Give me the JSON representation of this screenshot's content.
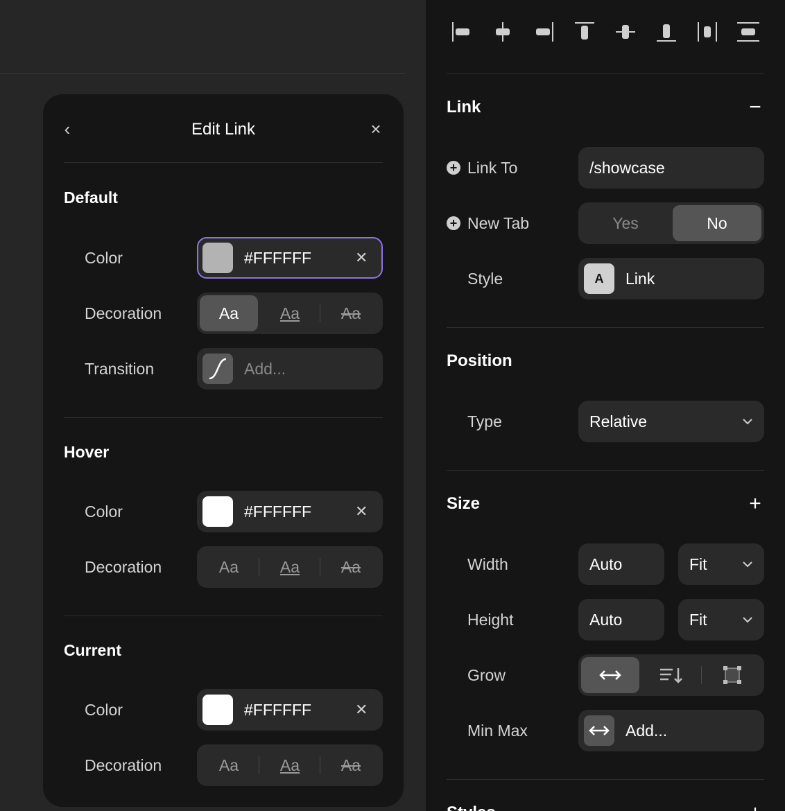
{
  "edit_link": {
    "title": "Edit Link",
    "back_icon": "chevron-left-icon",
    "close_icon": "close-icon",
    "sections": {
      "default": {
        "title": "Default",
        "color_label": "Color",
        "color_value": "#FFFFFF",
        "swatch_color": "#B3B3B3",
        "decoration_label": "Decoration",
        "decoration_options": [
          "Aa",
          "Aa",
          "Aa"
        ],
        "decoration_selected": 0,
        "transition_label": "Transition",
        "transition_placeholder": "Add..."
      },
      "hover": {
        "title": "Hover",
        "color_label": "Color",
        "color_value": "#FFFFFF",
        "swatch_color": "#FFFFFF",
        "decoration_label": "Decoration",
        "decoration_options": [
          "Aa",
          "Aa",
          "Aa"
        ]
      },
      "current": {
        "title": "Current",
        "color_label": "Color",
        "color_value": "#FFFFFF",
        "swatch_color": "#FFFFFF",
        "decoration_label": "Decoration",
        "decoration_options": [
          "Aa",
          "Aa",
          "Aa"
        ]
      }
    },
    "focus_color": "#8F72E6"
  },
  "panel": {
    "align_icons": [
      "align-left-icon",
      "align-center-horizontal-icon",
      "align-right-icon",
      "align-top-icon",
      "align-center-vertical-icon",
      "align-bottom-icon",
      "distribute-horizontal-icon",
      "distribute-vertical-icon"
    ],
    "link": {
      "title": "Link",
      "action": "−",
      "link_to_label": "Link To",
      "link_to_value": "/showcase",
      "new_tab_label": "New Tab",
      "new_tab_options": [
        "Yes",
        "No"
      ],
      "new_tab_selected": "No",
      "style_label": "Style",
      "style_chip": "A",
      "style_value": "Link"
    },
    "position": {
      "title": "Position",
      "type_label": "Type",
      "type_value": "Relative"
    },
    "size": {
      "title": "Size",
      "action": "+",
      "width_label": "Width",
      "width_value": "Auto",
      "width_mode": "Fit",
      "height_label": "Height",
      "height_value": "Auto",
      "height_mode": "Fit",
      "grow_label": "Grow",
      "grow_selected": "grow-horizontal",
      "minmax_label": "Min Max",
      "minmax_placeholder": "Add..."
    },
    "styles": {
      "title": "Styles",
      "action": "+"
    }
  }
}
